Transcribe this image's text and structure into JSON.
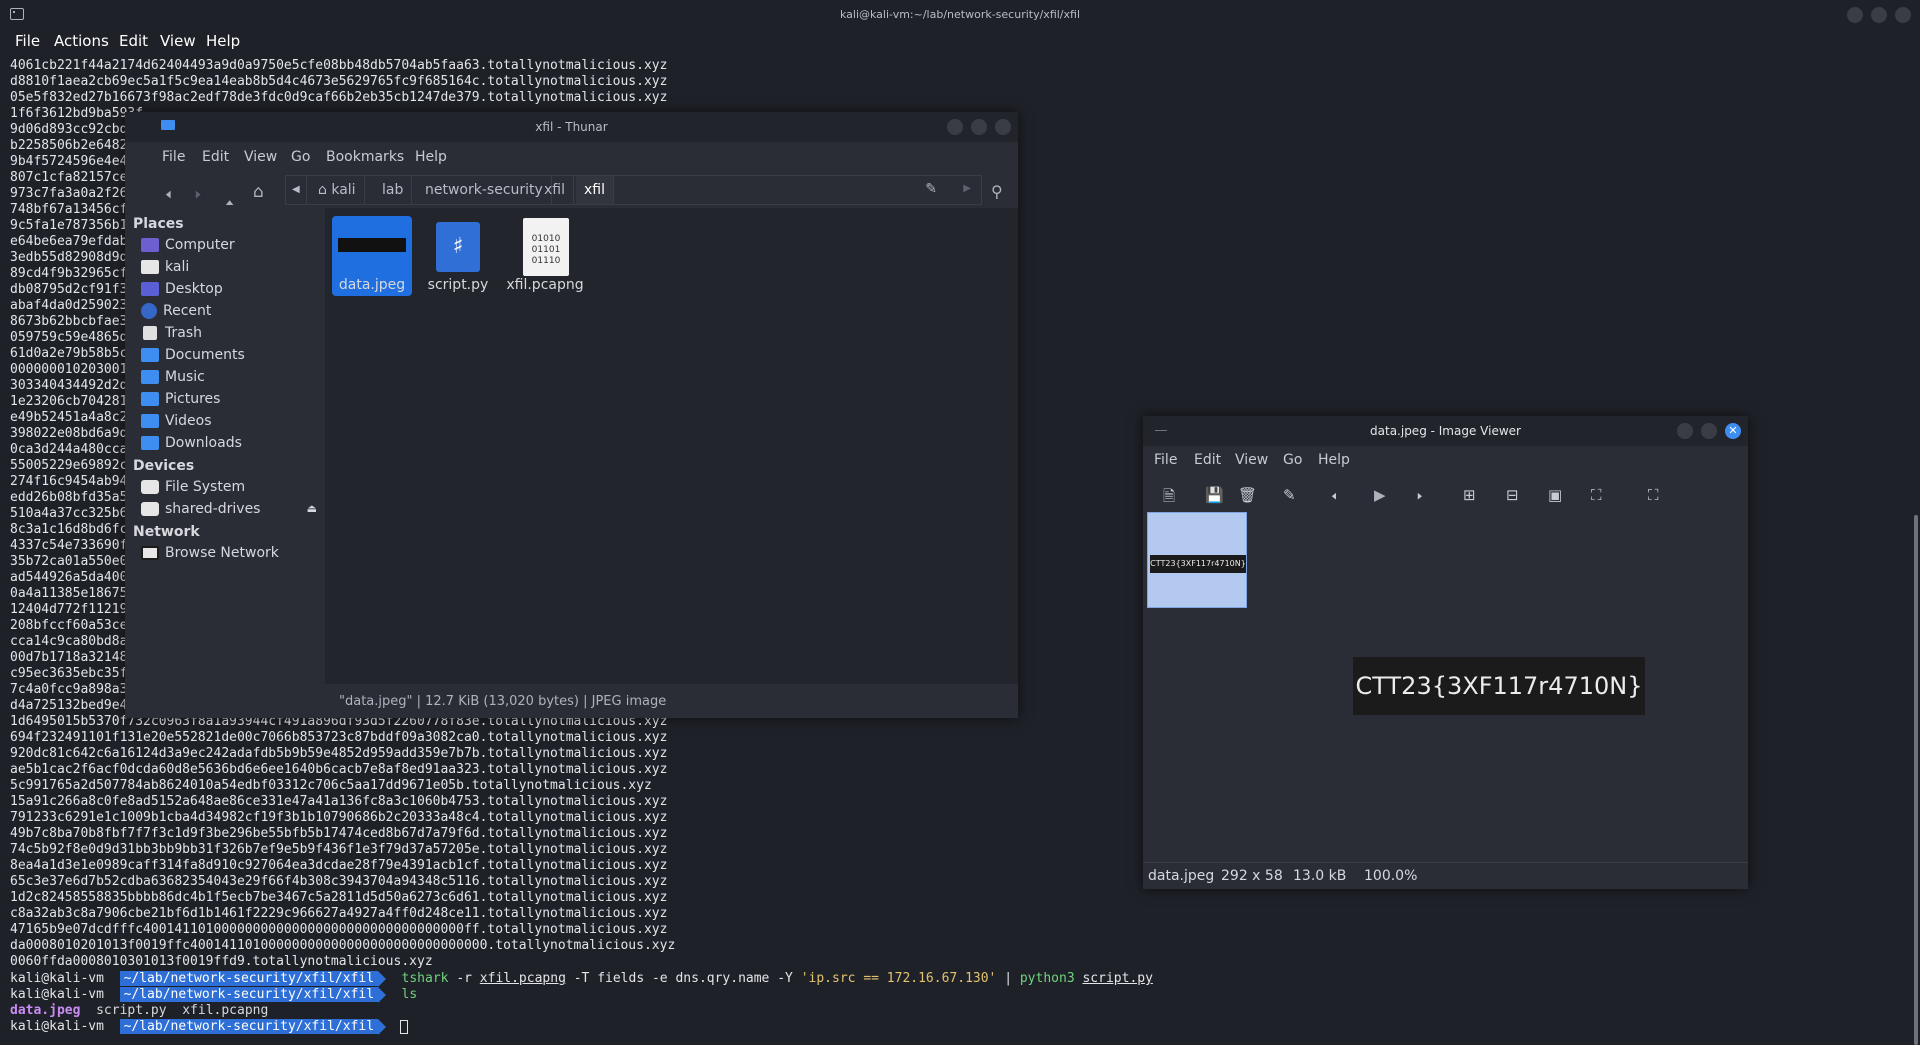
{
  "terminal": {
    "title": "kali@kali-vm:~/lab/network-security/xfil/xfil",
    "menu": [
      "File",
      "Actions",
      "Edit",
      "View",
      "Help"
    ],
    "lines_top": [
      "4061cb221f44a2174d62404493a9d0a9750e5cfe08bb48db5704ab5faa63.totallynotmalicious.xyz",
      "d8810f1aea2cb69ec5a1f5c9ea14eab8b5d4c4673e5629765fc9f685164c.totallynotmalicious.xyz",
      "05e5f832ed27b16673f98ac2edf78de3fdc0d9caf66b2eb35cb1247de379.totallynotmalicious.xyz",
      "1f6f3612bd9ba593f",
      "9d06d893cc92cbd0e",
      "b2258506b2e64820b",
      "9b4f5724596e4e449",
      "807c1cfa82157ce32",
      "973c7fa3a0a2f260d",
      "748bf67a13456cf2a",
      "9c5fa1e787356b1a2",
      "e64be6ea79efdabe8",
      "3edb55d82908d9d62",
      "89cd4f9b32965cf24",
      "db08795d2cf91f3a4",
      "abaf4da0d2590234",
      "8673b62bbcbfae3d6",
      "059759c59e4865d7f",
      "61d0a2e79b58b5c6b",
      "00000001020300111",
      "303340434492d2d3e",
      "1e23206cb70428151",
      "e49b52451a4a8c2f1",
      "398022e08bd6a9d26",
      "0ca3d244a480ccaca",
      "55005229e69892c42",
      "274f16c9454ab945a",
      "edd26b08bfd35a5eb",
      "510a4a37cc325b618",
      "8c3a1c16d8bd6fc6b",
      "4337c54e733690f22",
      "35b72ca01a550e031",
      "ad544926a5da4009b",
      "0a4a11385e1867524",
      "12404d772f1121901",
      "208bfccf60a53ceb2",
      "cca14c9ca80bd8a6a",
      "00d7b1718a3214852",
      "c95ec3635ebc35f1d",
      "7c4a0fcc9a898a398",
      "d4a725132bed9e477",
      "1d6495015b5370f732c0963f8a1a93944cf491a896df93d5f2260778f83e.totallynotmalicious.xyz",
      "694f232491101f131e20e552821de00c7066b853723c87bddf09a3082ca0.totallynotmalicious.xyz",
      "920dc81c642c6a16124d3a9ec242adafdb5b9b59e4852d959add359e7b7b.totallynotmalicious.xyz",
      "ae5b1cac2f6acf0dcda60d8e5636bd6e6ee1640b6cacb7e8af8ed91aa323.totallynotmalicious.xyz",
      "5c991765a2d507784ab8624010a54edbf03312c706c5aa17dd9671e05b.totallynotmalicious.xyz",
      "15a91c266a8c0fe8ad5152a648ae86ce331e47a41a136fc8a3c1060b4753.totallynotmalicious.xyz",
      "791233c6291e1c1009b1cba4d34982cf19f3b1b10790686b2c20333a48c4.totallynotmalicious.xyz",
      "49b7c8ba70b8fbf7f7f3c1d9f3be296be55bfb5b17474ced8b67d7a79f6d.totallynotmalicious.xyz",
      "74c5b92f8e0d9d31bb3bb9bb31f326b7ef9e5b9f436f1e3f79d37a57205e.totallynotmalicious.xyz",
      "8ea4a1d3e1e0989caff314fa8d910c927064ea3dcdae28f79e4391acb1cf.totallynotmalicious.xyz",
      "65c3e37e6d7b52cdba63682354043e29f66f4b308c3943704a94348c5116.totallynotmalicious.xyz",
      "1d2c82458558835bbbb86dc4b1f5ecb7be3467c5a2811d5d50a6273c6d61.totallynotmalicious.xyz",
      "c8a32ab3c8a7906cbe21bf6d1b1461f2229c966627a4927a4ff0d248ce11.totallynotmalicious.xyz",
      "47165b9e07dcdfffc40014110100000000000000000000000000000000ff.totallynotmalicious.xyz",
      "da0008010201013f0019ffc40014110100000000000000000000000000000.totallynotmalicious.xyz",
      "0060ffda0008010301013f0019ffd9.totallynotmalicious.xyz"
    ],
    "prompt_user": "kali@kali-vm",
    "prompt_path": "~/lab/network-security/xfil/xfil",
    "cmd1": {
      "tshark": "tshark",
      "flag_r": "-r",
      "file": "xfil.pcapng",
      "rest": "-T fields -e dns.qry.name -Y",
      "filter": "'ip.src == 172.16.67.130'",
      "pipe": "|",
      "python": "python3",
      "script": "script.py"
    },
    "cmd2": "ls",
    "ls_output": {
      "jpeg": "data.jpeg",
      "py": "script.py",
      "pcap": "xfil.pcapng"
    }
  },
  "thunar": {
    "title": "xfil - Thunar",
    "menu": [
      "File",
      "Edit",
      "View",
      "Go",
      "Bookmarks",
      "Help"
    ],
    "path": [
      "kali",
      "lab",
      "network-security",
      "xfil",
      "xfil"
    ],
    "sidebar": {
      "places_header": "Places",
      "places": [
        "Computer",
        "kali",
        "Desktop",
        "Recent",
        "Trash",
        "Documents",
        "Music",
        "Pictures",
        "Videos",
        "Downloads"
      ],
      "devices_header": "Devices",
      "devices": [
        "File System",
        "shared-drives"
      ],
      "network_header": "Network",
      "network": [
        "Browse Network"
      ]
    },
    "files": [
      {
        "name": "data.jpeg",
        "selected": true
      },
      {
        "name": "script.py",
        "selected": false
      },
      {
        "name": "xfil.pcapng",
        "selected": false
      }
    ],
    "pcap_icon_text": [
      "01010",
      "01101",
      "01110"
    ],
    "status": "\"data.jpeg\" | 12.7 KiB (13,020 bytes) | JPEG image"
  },
  "viewer": {
    "title": "data.jpeg - Image Viewer",
    "menu": [
      "File",
      "Edit",
      "View",
      "Go",
      "Help"
    ],
    "image_text": "CTT23{3XF117r4710N}",
    "status": {
      "filename": "data.jpeg",
      "dimensions": "292 x 58",
      "size": "13.0 kB",
      "zoom": "100.0%"
    }
  },
  "colors": {
    "accent": "#2d6fd6",
    "selection": "#1f6fe0",
    "terminal_bg": "#1f2129"
  }
}
